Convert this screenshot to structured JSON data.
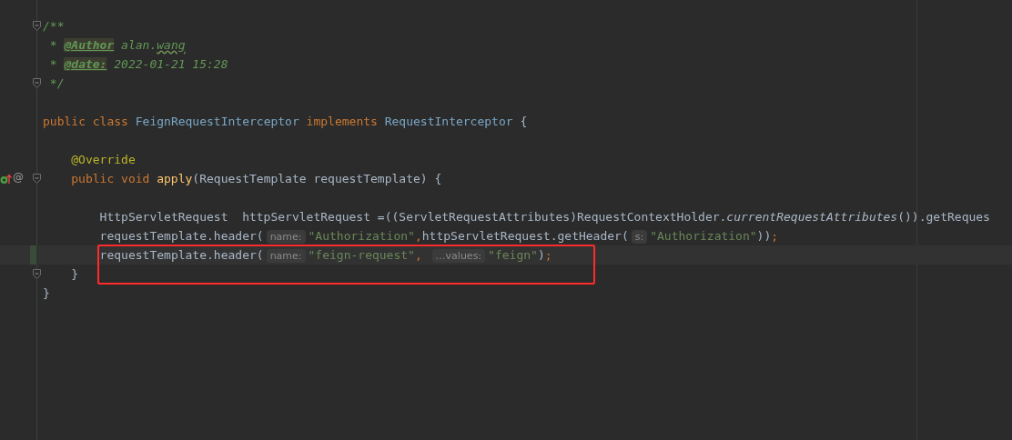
{
  "editor": {
    "lines": [
      {
        "fold": true,
        "tokens": [
          {
            "kind": "comment",
            "t": "/**"
          }
        ]
      },
      {
        "tokens": [
          {
            "kind": "comment",
            "t": " * "
          },
          {
            "kind": "doc-tag",
            "t": "@Author"
          },
          {
            "kind": "comment",
            "t": " alan."
          },
          {
            "kind": "typo",
            "t": "wang"
          }
        ]
      },
      {
        "tokens": [
          {
            "kind": "comment",
            "t": " * "
          },
          {
            "kind": "doc-tag",
            "t": "@date:"
          },
          {
            "kind": "comment",
            "t": " 2022-01-21 15:28"
          }
        ]
      },
      {
        "fold": true,
        "tokens": [
          {
            "kind": "comment",
            "t": " */"
          }
        ]
      },
      {
        "kind": "blank"
      },
      {
        "tokens": [
          {
            "kind": "keyword",
            "t": "public class "
          },
          {
            "kind": "class",
            "t": "FeignRequestInterceptor"
          },
          {
            "kind": "keyword",
            "t": " implements "
          },
          {
            "kind": "class",
            "t": "RequestInterceptor"
          },
          {
            "kind": "plain",
            "t": " {"
          }
        ],
        "children": [
          {
            "kind": "blank"
          },
          {
            "tokens": [
              {
                "kind": "annotation",
                "t": "@Override"
              }
            ]
          },
          {
            "fold": true,
            "gutter": {
              "kind": "override",
              "mark": "@"
            },
            "tokens": [
              {
                "kind": "keyword",
                "t": "public void "
              },
              {
                "kind": "method",
                "t": "apply"
              },
              {
                "kind": "plain",
                "t": "(RequestTemplate requestTemplate) {"
              }
            ],
            "children": [
              {
                "kind": "blank"
              },
              {
                "tokens": [
                  {
                    "kind": "plain",
                    "t": "HttpServletRequest  httpServletRequest =((ServletRequestAttributes)RequestContextHolder."
                  },
                  {
                    "kind": "static",
                    "t": "currentRequestAttributes"
                  },
                  {
                    "kind": "plain",
                    "t": "()).getReques"
                  }
                ]
              },
              {
                "tokens": [
                  {
                    "kind": "plain",
                    "t": "requestTemplate.header("
                  },
                  {
                    "kind": "hint",
                    "t": "name:"
                  },
                  {
                    "kind": "string",
                    "t": "\"Authorization\""
                  },
                  {
                    "kind": "keyword",
                    "t": ","
                  },
                  {
                    "kind": "plain",
                    "t": "httpServletRequest.getHeader("
                  },
                  {
                    "kind": "hint",
                    "t": "s:"
                  },
                  {
                    "kind": "string",
                    "t": "\"Authorization\""
                  },
                  {
                    "kind": "plain",
                    "t": "))"
                  },
                  {
                    "kind": "keyword",
                    "t": ";"
                  }
                ]
              },
              {
                "current": true,
                "changed": true,
                "boxed": true,
                "tokens": [
                  {
                    "kind": "plain",
                    "t": "requestTemplate.header("
                  },
                  {
                    "kind": "hint",
                    "t": "name:"
                  },
                  {
                    "kind": "string",
                    "t": "\"feign-request\""
                  },
                  {
                    "kind": "keyword",
                    "t": ", "
                  },
                  {
                    "kind": "hint",
                    "t": "…values:"
                  },
                  {
                    "kind": "string",
                    "t": "\"feign\""
                  },
                  {
                    "kind": "plain",
                    "t": ")"
                  },
                  {
                    "kind": "keyword",
                    "t": ";"
                  }
                ]
              }
            ]
          },
          {
            "fold": true,
            "tokens": [
              {
                "kind": "plain",
                "t": "}"
              }
            ]
          }
        ]
      },
      {
        "tokens": [
          {
            "kind": "plain",
            "t": "}"
          }
        ]
      }
    ]
  }
}
